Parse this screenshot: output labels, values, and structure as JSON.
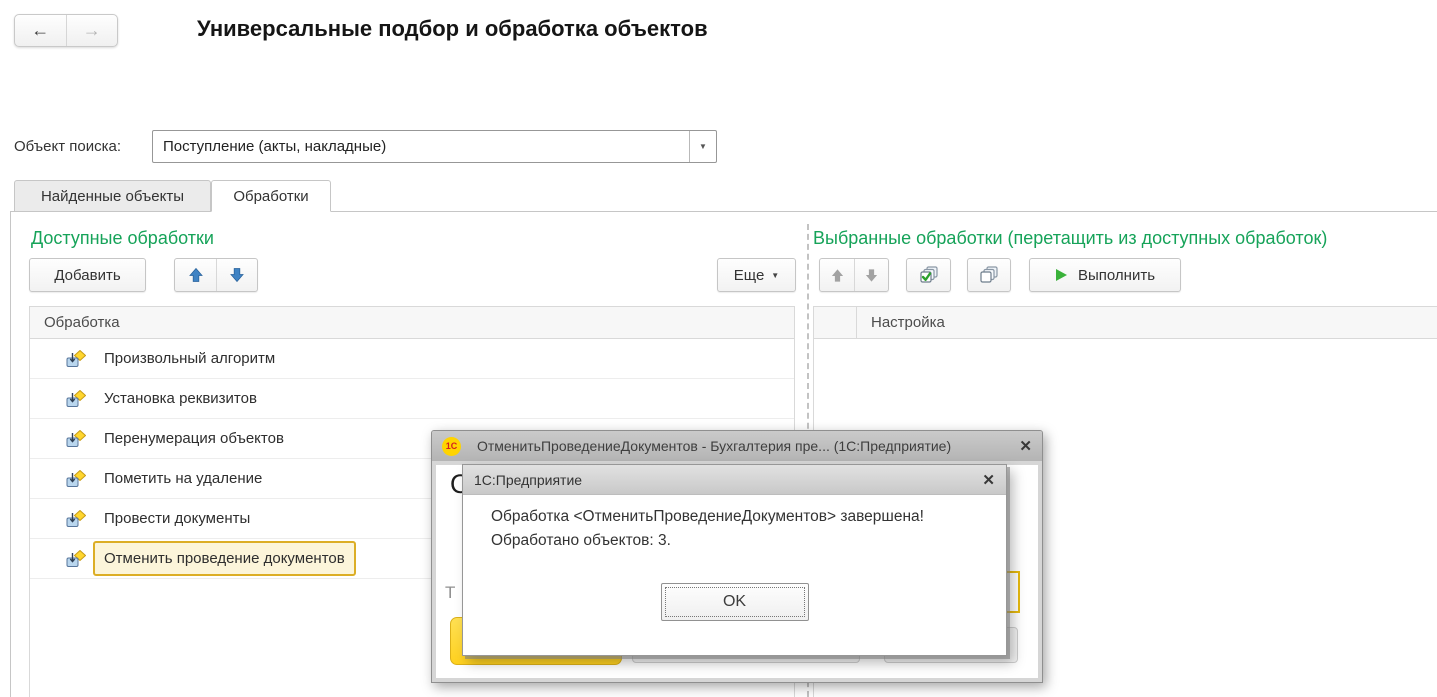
{
  "header": {
    "title": "Универсальные подбор и обработка объектов",
    "back_icon": "←",
    "forward_icon": "→"
  },
  "search": {
    "label": "Объект поиска:",
    "value": "Поступление (акты, накладные)",
    "caret_icon": "▼"
  },
  "tabs": [
    {
      "label": "Найденные объекты",
      "active": false
    },
    {
      "label": "Обработки",
      "active": true
    }
  ],
  "left_panel": {
    "title": "Доступные обработки",
    "add_button": "Добавить",
    "more_button": "Еще",
    "more_caret": "▼",
    "table_header": "Обработка",
    "rows": [
      {
        "label": "Произвольный алгоритм",
        "selected": false
      },
      {
        "label": "Установка реквизитов",
        "selected": false
      },
      {
        "label": "Перенумерация объектов",
        "selected": false
      },
      {
        "label": "Пометить на удаление",
        "selected": false
      },
      {
        "label": "Провести документы",
        "selected": false
      },
      {
        "label": "Отменить проведение документов",
        "selected": true
      }
    ]
  },
  "right_panel": {
    "title": "Выбранные обработки (перетащить из доступных обработок)",
    "execute_button": "Выполнить",
    "table_header": "Настройка"
  },
  "modal": {
    "logo": "1С",
    "title": "ОтменитьПроведениеДокументов - Бухгалтерия пре...  (1С:Предприятие)",
    "close_icon": "✕",
    "fragments": {
      "letter_o": "О",
      "letter_t": "Т"
    }
  },
  "dialog": {
    "title": "1С:Предприятие",
    "close_icon": "✕",
    "message_line1": "Обработка <ОтменитьПроведениеДокументов> завершена!",
    "message_line2": "Обработано объектов: 3.",
    "ok_button": "OK"
  },
  "icons": {
    "move-up": "arrow-up-blue",
    "move-down": "arrow-down-blue",
    "check-all": "stacked-pages-green-check",
    "uncheck-all": "stacked-pages",
    "execute": "green-play-triangle",
    "row": "external-processor"
  },
  "colors": {
    "accent_green": "#16a359",
    "arrow_blue": "#3f83c4",
    "arrow_disabled": "#a2a2a2",
    "play_green": "#3ab23a",
    "highlight_border": "#dcae26",
    "highlight_bg": "#fcf5da",
    "logo_bg": "#ffd400",
    "logo_text": "#d31f1f",
    "yellow_button": "#ffd11f"
  }
}
